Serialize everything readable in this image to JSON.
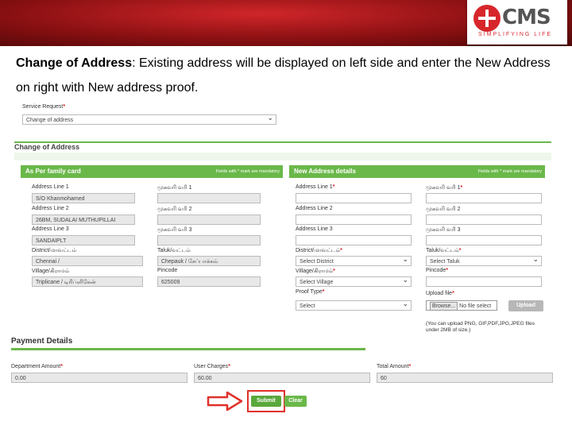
{
  "logo": {
    "name": "cms",
    "tagline": "SIMPLIFYING LIFE",
    "brand_color": "#d7262b"
  },
  "caption": {
    "bold": "Change of Address",
    "text": ": Existing address will be displayed on left side and enter the New Address on right with New address proof."
  },
  "service_request": {
    "label": "Service Request",
    "value": "Change of address"
  },
  "page_title": "Change of Address",
  "left_panel": {
    "title": "As Per family card",
    "mandatory_note": "Fields with * mark are mandatory",
    "address_line_1": {
      "label": "Address Line 1",
      "value": "S/O Khanmohamed"
    },
    "address_line_1_ta": {
      "label": "முகவரி வரி 1",
      "value": ""
    },
    "address_line_2": {
      "label": "Address Line 2",
      "value": "26BM, SUDALAI MUTHUPILLAI"
    },
    "address_line_2_ta": {
      "label": "முகவரி வரி 2",
      "value": ""
    },
    "address_line_3": {
      "label": "Address Line 3",
      "value": "SANDAIPLT"
    },
    "address_line_3_ta": {
      "label": "முகவரி வரி 3",
      "value": ""
    },
    "district": {
      "label": "District/மாவட்டம்",
      "value": "Chennai /"
    },
    "taluk": {
      "label": "Taluk/வட்டம்",
      "value": "Chepauk / சேப்பாக்கம்"
    },
    "village": {
      "label": "Village/கிராமம்",
      "value": "Triplicane / டிரிப்ளிகேன்"
    },
    "pincode": {
      "label": "Pincode",
      "value": "625009"
    }
  },
  "right_panel": {
    "title": "New Address details",
    "mandatory_note": "Fields with * mark are mandatory",
    "address_line_1": {
      "label": "Address Line 1",
      "value": ""
    },
    "address_line_1_ta": {
      "label": "முகவரி வரி 1",
      "value": ""
    },
    "address_line_2": {
      "label": "Address Line 2",
      "value": ""
    },
    "address_line_2_ta": {
      "label": "முகவரி வரி 2",
      "value": ""
    },
    "address_line_3": {
      "label": "Address Line 3",
      "value": ""
    },
    "address_line_3_ta": {
      "label": "முகவரி வரி 3",
      "value": ""
    },
    "district": {
      "label": "District/மாவட்டம்",
      "value": "Select District"
    },
    "taluk": {
      "label": "Taluk/வட்டம்",
      "value": "Select Taluk"
    },
    "village": {
      "label": "Village/கிராமம்",
      "value": "Select Village"
    },
    "pincode": {
      "label": "Pincode",
      "value": ""
    },
    "proof_type": {
      "label": "Proof Type",
      "value": "Select"
    },
    "upload": {
      "label": "Upload file",
      "browse": "Browse...",
      "no_file": "No file select",
      "button": "Upload",
      "hint": "(You can upload PNG, GIF,PDF,JPG,JPEG files under 2MB of size.)"
    }
  },
  "payment": {
    "title": "Payment Details",
    "department_amount": {
      "label": "Department Amount",
      "value": "0.00"
    },
    "user_charges": {
      "label": "User Charges",
      "value": "60.00"
    },
    "total_amount": {
      "label": "Total Amount",
      "value": "60"
    }
  },
  "buttons": {
    "submit": "Submit",
    "clear": "Clear"
  },
  "colors": {
    "green": "#6ab84a",
    "required": "#d9231f",
    "arrow": "#e0302a"
  }
}
